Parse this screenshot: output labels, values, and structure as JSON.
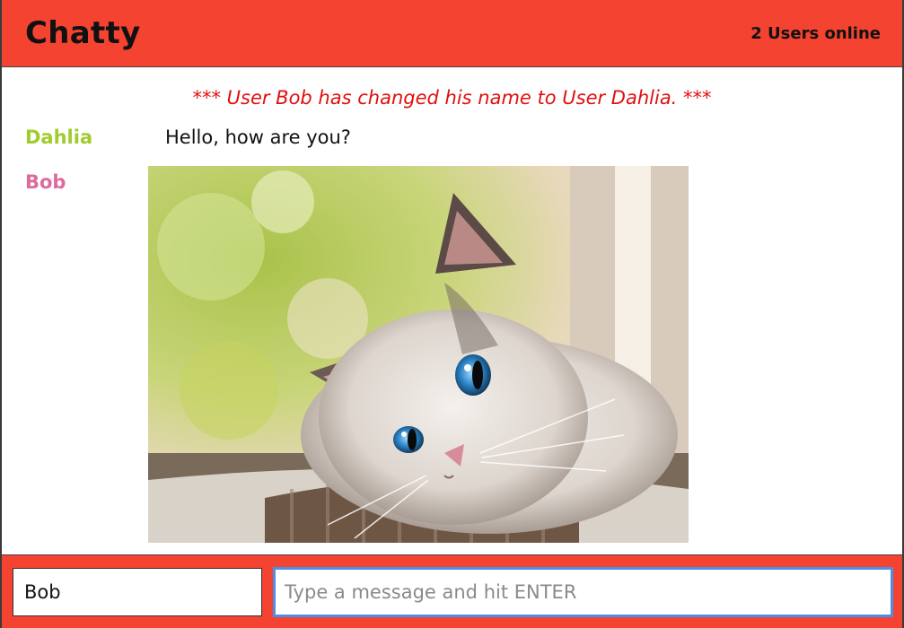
{
  "app": {
    "brand": "Chatty",
    "users_online": "2 Users online"
  },
  "messages": {
    "system_notice": "*** User Bob has changed his name to User Dahlia. ***",
    "items": [
      {
        "username": "Dahlia",
        "text": "Hello, how are you?",
        "color": "#a0cc2e"
      },
      {
        "username": "Bob",
        "image": "kitten photo",
        "color": "#dd6b9c"
      }
    ]
  },
  "composer": {
    "name_value": "Bob",
    "message_placeholder": "Type a message and hit ENTER"
  },
  "colors": {
    "accent": "#f44330",
    "system": "#e01010",
    "focus": "#4a8fe8"
  }
}
